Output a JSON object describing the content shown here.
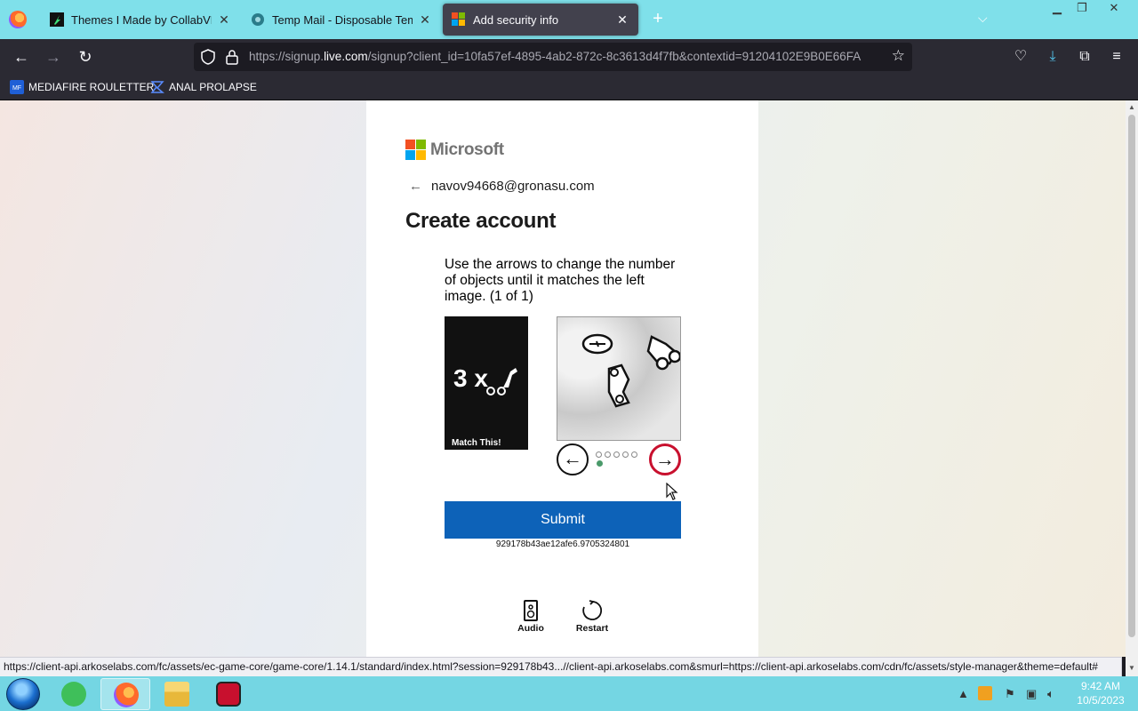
{
  "tabs": [
    {
      "title": "Themes I Made by CollabVMUs",
      "favicon_color": "#1a1a1a"
    },
    {
      "title": "Temp Mail - Disposable Tempo",
      "favicon_color": "#2a7c8a"
    },
    {
      "title": "Add security info",
      "favicon_color": "#f25022"
    }
  ],
  "new_tab_label": "+",
  "url": {
    "prefix": "https://signup.",
    "domain": "live.com",
    "rest": "/signup?client_id=10fa57ef-4895-4ab2-872c-8c3613d4f7fb&contextid=91204102E9B0E66FA"
  },
  "bookmarks": [
    {
      "label": "MEDIAFIRE ROULETTER",
      "icon": "mediafire-icon"
    },
    {
      "label": "ANAL PROLAPSE",
      "icon": "bookmark-icon"
    }
  ],
  "page": {
    "brand": "Microsoft",
    "email": "navov94668@gronasu.com",
    "heading": "Create account",
    "instructions": "Use the arrows to change the number of objects until it matches the left image. (1 of 1)",
    "match_count": "3 x",
    "match_label": "Match This!",
    "progress_dots_total": 5,
    "progress_dot_active": 1,
    "submit_label": "Submit",
    "session_id": "929178b43ae12afe6.9705324801",
    "audio_label": "Audio",
    "restart_label": "Restart"
  },
  "status_url": "https://client-api.arkoselabs.com/fc/assets/ec-game-core/game-core/1.14.1/standard/index.html?session=929178b43...//client-api.arkoselabs.com&smurl=https://client-api.arkoselabs.com/cdn/fc/assets/style-manager&theme=default#",
  "clock": {
    "time": "9:42 AM",
    "date": "10/5/2023"
  },
  "colors": {
    "accent": "#0d62b8",
    "tabbar": "#7fe0ea",
    "taskbar": "#74d6e3"
  }
}
